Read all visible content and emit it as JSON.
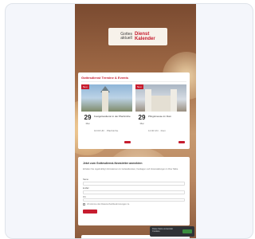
{
  "site": {
    "logo_line1": "Gottes",
    "logo_line2": "Dienst",
    "logo_line3": "aktuell",
    "logo_line4": "Kalender"
  },
  "events_section": {
    "heading": "Gottesdienst Termine & Events",
    "items": [
      {
        "tag": "Neu",
        "day": "29",
        "month": "Mai",
        "title": "Festgottesdienst in der Pfarrkirche",
        "meta": "10:00 Uhr · Pfarrkirche"
      },
      {
        "tag": "Neu",
        "day": "29",
        "month": "Mai",
        "title": "Pfingstmesse im Dom",
        "meta": "11:00 Uhr · Dom"
      }
    ]
  },
  "form": {
    "heading": "Jetzt zum Gottesdienst-Newsletter anmelden",
    "text": "Erhalten Sie regelmäßig Informationen zu Gottesdiensten, Festtagen und Veranstaltungen in Ihrer Nähe.",
    "name_label": "Name",
    "email_label": "E-Mail",
    "city_label": "Ort",
    "consent": "Ich stimme den Datenschutzbestimmungen zu."
  },
  "cookie": {
    "text": "Diese Seite verwendet Cookies."
  },
  "colors": {
    "accent": "#c61d2f",
    "cookie_bg": "#2f3236",
    "cookie_btn": "#3b8d3f"
  }
}
